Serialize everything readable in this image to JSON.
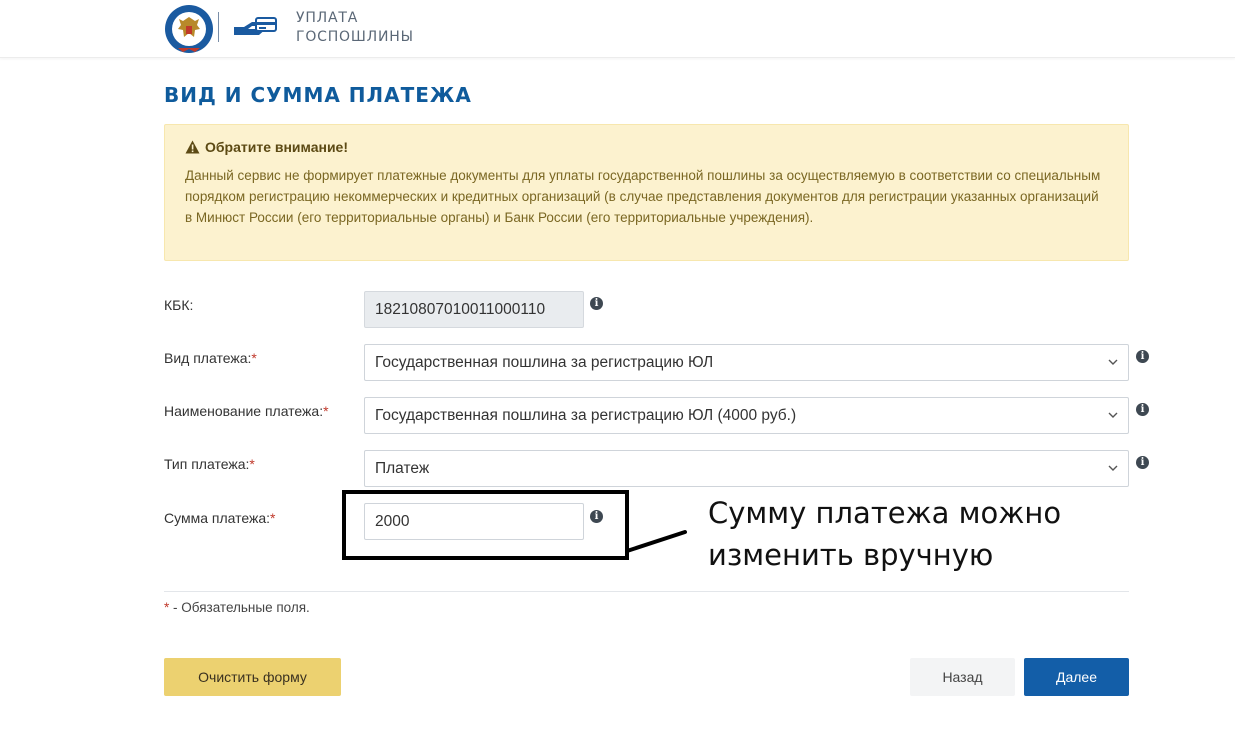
{
  "header": {
    "title_line1": "УПЛАТА",
    "title_line2": "ГОСПОШЛИНЫ",
    "logo_icon": "fns-emblem-icon",
    "service_icon": "hand-card-icon"
  },
  "page_title": "ВИД И СУММА ПЛАТЕЖА",
  "notice": {
    "icon": "warning-icon",
    "heading": "Обратите внимание!",
    "body": "Данный сервис не формирует платежные документы для уплаты государственной пошлины за осуществляемую в соответствии со специальным порядком регистрацию некоммерческих и кредитных организаций (в случае представления документов для регистрации указанных организаций в Минюст России (его территориальные органы) и Банк России (его территориальные учреждения)."
  },
  "form": {
    "kbk": {
      "label": "КБК:",
      "value": "18210807010011000110"
    },
    "payment_kind": {
      "label": "Вид платежа:",
      "required_mark": "*",
      "value": "Государственная пошлина за регистрацию ЮЛ"
    },
    "payment_name": {
      "label": "Наименование платежа:",
      "required_mark": "*",
      "value": "Государственная пошлина за регистрацию ЮЛ (4000 руб.)"
    },
    "payment_type": {
      "label": "Тип платежа:",
      "required_mark": "*",
      "value": "Платеж"
    },
    "payment_amount": {
      "label": "Сумма платежа:",
      "required_mark": "*",
      "value": "2000"
    }
  },
  "annotation": {
    "line1": "Сумму платежа можно",
    "line2": "изменить вручную"
  },
  "required_note": {
    "mark": "*",
    "text": " - Обязательные поля."
  },
  "buttons": {
    "clear": "Очистить форму",
    "back": "Назад",
    "next": "Далее"
  },
  "colors": {
    "accent": "#135ea8",
    "title": "#0f5b9c",
    "notice_bg": "#fcf2cf",
    "clear_button": "#ecd170",
    "required": "#c0392b"
  }
}
